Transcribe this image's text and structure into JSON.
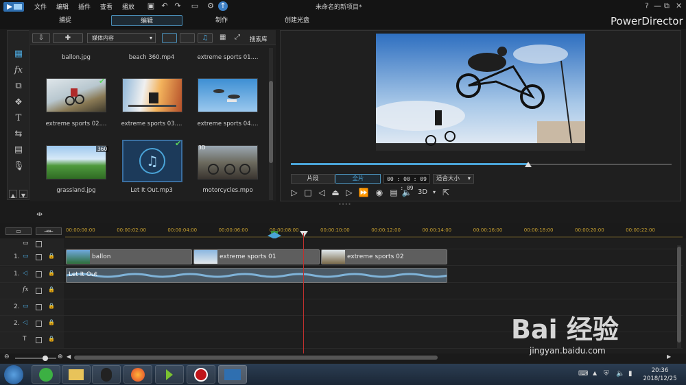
{
  "window": {
    "title": "未命名的新项目*",
    "app_name": "PowerDirector"
  },
  "menu": [
    "文件",
    "编辑",
    "插件",
    "查看",
    "播放"
  ],
  "tabs": [
    {
      "label": "捕捉"
    },
    {
      "label": "编辑",
      "active": true
    },
    {
      "label": "制作"
    },
    {
      "label": "创建光盘"
    }
  ],
  "window_controls": {
    "help": "?",
    "minimize": "—",
    "restore": "⧉",
    "close": "✕"
  },
  "library": {
    "media_select": "媒体内容",
    "search_label": "搜索库",
    "items": [
      {
        "name": "ballon.jpg"
      },
      {
        "name": "beach 360.mp4"
      },
      {
        "name": "extreme sports 01...."
      },
      {
        "name": "extreme sports 02....",
        "used": true
      },
      {
        "name": "extreme sports 03....",
        "used": false
      },
      {
        "name": "extreme sports 04...."
      },
      {
        "name": "grassland.jpg",
        "badge": "360"
      },
      {
        "name": "Let It Out.mp3",
        "used": true
      },
      {
        "name": "motorcycles.mpo",
        "badge": "3D"
      }
    ]
  },
  "preview": {
    "mode_clip": "片段",
    "mode_movie": "全片",
    "timecode": "00 : 00 : 09 : 09",
    "fit": "适合大小",
    "label_3d": "3D",
    "scrub_position": 0.62
  },
  "timeline": {
    "ruler_ticks": [
      "00:00:00:00",
      "00:00:02:00",
      "00:00:04:00",
      "00:00:06:00",
      "00:00:08:00",
      "00:00:10:00",
      "00:00:12:00",
      "00:00:14:00",
      "00:00:16:00",
      "00:00:18:00",
      "00:00:20:00",
      "00:00:22:00"
    ],
    "tracks": [
      {
        "label": "",
        "icon": "master-icon"
      },
      {
        "label": "1.",
        "icon": "video-track-icon"
      },
      {
        "label": "1.",
        "icon": "audio-track-icon"
      },
      {
        "label": "",
        "icon": "fx-icon",
        "text": "fx"
      },
      {
        "label": "2.",
        "icon": "video-track-icon"
      },
      {
        "label": "2.",
        "icon": "audio-track-icon"
      },
      {
        "label": "",
        "icon": "title-icon",
        "text": "T"
      }
    ],
    "video_clips": [
      "ballon",
      "extreme sports 01",
      "extreme sports 02"
    ],
    "audio_clip": "Let It Out"
  },
  "taskbar": {
    "time": "20:36",
    "date": "2018/12/25"
  },
  "watermark": {
    "brand": "Bai 经验",
    "url": "jingyan.baidu.com"
  },
  "colors": {
    "accent": "#4aa4d8",
    "playhead": "#c0302e",
    "check": "#5cd65c"
  }
}
